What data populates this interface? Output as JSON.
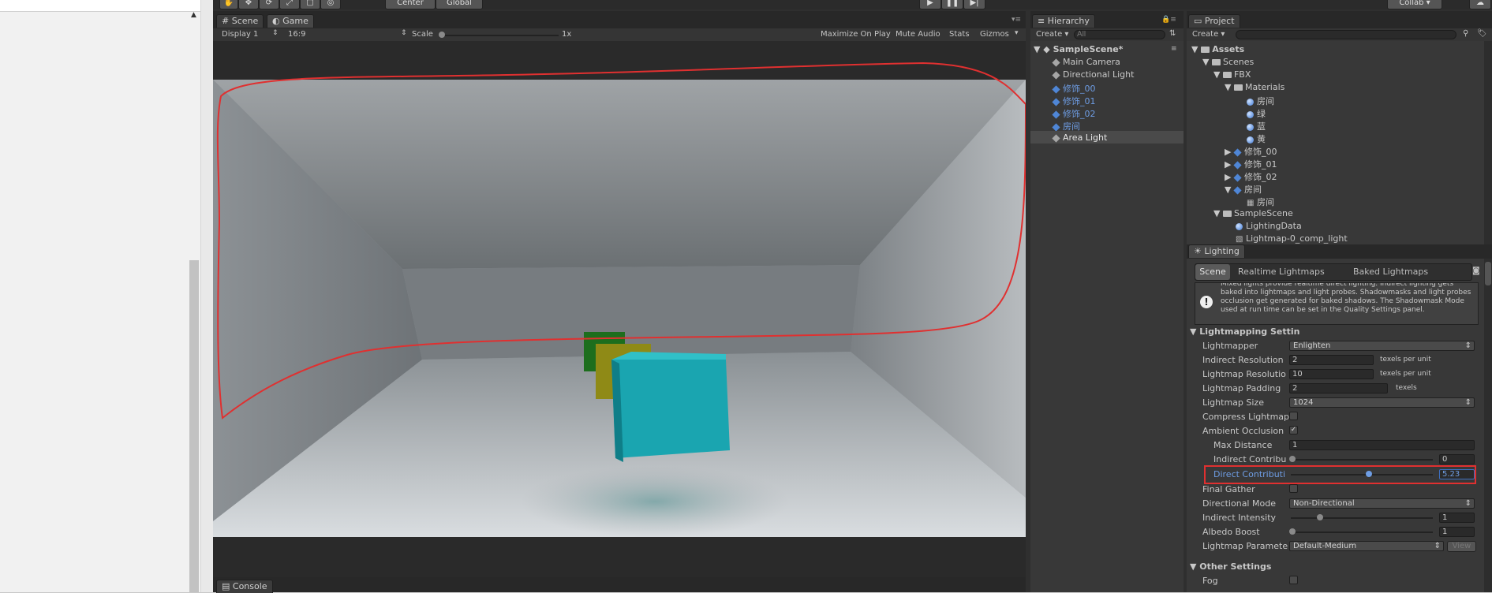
{
  "toolbar": {
    "pivot": "Center",
    "space": "Global",
    "collab": "Collab"
  },
  "scene_tabs": {
    "scene": "Scene",
    "game": "Game"
  },
  "game_bar": {
    "display": "Display 1",
    "aspect": "16:9",
    "scale_label": "Scale",
    "scale_value": "1x",
    "maximize": "Maximize On Play",
    "mute": "Mute Audio",
    "stats": "Stats",
    "gizmos": "Gizmos"
  },
  "console_tab": "Console",
  "hierarchy": {
    "tab": "Hierarchy",
    "create": "Create",
    "search_placeholder": "All",
    "scene": "SampleScene*",
    "items": [
      {
        "label": "Main Camera",
        "blue": false
      },
      {
        "label": "Directional Light",
        "blue": false
      },
      {
        "label": "修饰_00",
        "blue": true
      },
      {
        "label": "修饰_01",
        "blue": true
      },
      {
        "label": "修饰_02",
        "blue": true
      },
      {
        "label": "房间",
        "blue": true
      },
      {
        "label": "Area Light",
        "blue": false
      }
    ]
  },
  "project": {
    "tab": "Project",
    "create": "Create",
    "tree": {
      "assets": "Assets",
      "scenes": "Scenes",
      "fbx": "FBX",
      "materials": "Materials",
      "mat1": "房间",
      "mat2": "绿",
      "mat3": "蓝",
      "mat4": "黄",
      "m0": "修饰_00",
      "m1": "修饰_01",
      "m2": "修饰_02",
      "room": "房间",
      "room_mesh": "房间",
      "samplescene": "SampleScene",
      "lightingdata": "LightingData",
      "lightmap": "Lightmap-0_comp_light"
    }
  },
  "lighting": {
    "tab": "Lighting",
    "subtabs": {
      "scene": "Scene",
      "realtime": "Realtime Lightmaps",
      "baked": "Baked Lightmaps"
    },
    "info": "Mixed lights provide realtime direct lighting. Indirect lighting gets baked into lightmaps and light probes. Shadowmasks and light probes occlusion get generated for baked shadows. The Shadowmask Mode used at run time can be set in the Quality Settings panel.",
    "section": "Lightmapping Settin",
    "lightmapper": {
      "label": "Lightmapper",
      "value": "Enlighten"
    },
    "indirect_res": {
      "label": "Indirect Resolution",
      "value": "2",
      "unit": "texels per unit"
    },
    "lightmap_res": {
      "label": "Lightmap Resolutio",
      "value": "10",
      "unit": "texels per unit"
    },
    "padding": {
      "label": "Lightmap Padding",
      "value": "2",
      "unit": "texels"
    },
    "size": {
      "label": "Lightmap Size",
      "value": "1024"
    },
    "compress": {
      "label": "Compress Lightmap"
    },
    "ao": {
      "label": "Ambient Occlusion",
      "check": "✓"
    },
    "max_distance": {
      "label": "Max Distance",
      "value": "1"
    },
    "indirect_contrib": {
      "label": "Indirect Contribu",
      "value": "0"
    },
    "direct_contrib": {
      "label": "Direct Contributi",
      "value": "5.23"
    },
    "final_gather": {
      "label": "Final Gather"
    },
    "directional": {
      "label": "Directional Mode",
      "value": "Non-Directional"
    },
    "indirect_intensity": {
      "label": "Indirect Intensity",
      "value": "1"
    },
    "albedo": {
      "label": "Albedo Boost",
      "value": "1"
    },
    "params": {
      "label": "Lightmap Paramete",
      "value": "Default-Medium",
      "view": "View"
    },
    "other": "Other Settings",
    "fog": "Fog"
  },
  "colors": {
    "highlight": "#e03030",
    "blue_text": "#6e9de4"
  }
}
